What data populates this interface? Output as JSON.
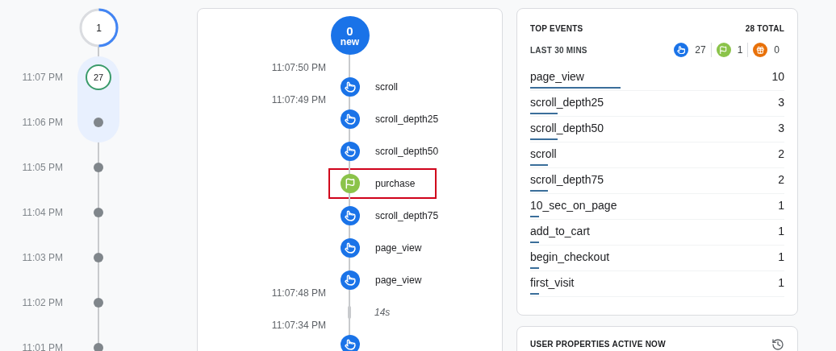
{
  "minute_timeline": {
    "current_count": "1",
    "minutes": [
      {
        "time": "11:07 PM",
        "count": "27",
        "selected": true
      },
      {
        "time": "11:06 PM",
        "selected": false
      },
      {
        "time": "11:05 PM",
        "selected": false
      },
      {
        "time": "11:04 PM",
        "selected": false
      },
      {
        "time": "11:03 PM",
        "selected": false
      },
      {
        "time": "11:02 PM",
        "selected": false
      },
      {
        "time": "11:01 PM",
        "selected": false
      }
    ]
  },
  "event_stream": {
    "new_count": "0",
    "new_label": "new",
    "items": [
      {
        "kind": "time",
        "text": "11:07:50 PM"
      },
      {
        "kind": "touch",
        "name": "scroll",
        "highlighted": false
      },
      {
        "kind": "time",
        "text": "11:07:49 PM"
      },
      {
        "kind": "touch",
        "name": "scroll_depth25",
        "highlighted": false
      },
      {
        "kind": "touch",
        "name": "scroll_depth50",
        "highlighted": false
      },
      {
        "kind": "flag",
        "name": "purchase",
        "highlighted": true
      },
      {
        "kind": "touch",
        "name": "scroll_depth75",
        "highlighted": false
      },
      {
        "kind": "touch",
        "name": "page_view",
        "highlighted": false
      },
      {
        "kind": "touch",
        "name": "page_view",
        "highlighted": false
      },
      {
        "kind": "time",
        "text": "11:07:48 PM"
      },
      {
        "kind": "gap",
        "text": "14s"
      },
      {
        "kind": "time",
        "text": "11:07:34 PM"
      },
      {
        "kind": "touch",
        "highlighted": false
      }
    ]
  },
  "top_events": {
    "title": "TOP EVENTS",
    "total": "28 TOTAL",
    "period": "LAST 30 MINS",
    "type_counts": [
      {
        "kind": "touch",
        "count": "27"
      },
      {
        "kind": "flag",
        "count": "1"
      },
      {
        "kind": "gift",
        "count": "0"
      }
    ],
    "rows": [
      {
        "name": "page_view",
        "count": "10",
        "level": 0.357
      },
      {
        "name": "scroll_depth25",
        "count": "3",
        "level": 0.107
      },
      {
        "name": "scroll_depth50",
        "count": "3",
        "level": 0.107
      },
      {
        "name": "scroll",
        "count": "2",
        "level": 0.071
      },
      {
        "name": "scroll_depth75",
        "count": "2",
        "level": 0.071
      },
      {
        "name": "10_sec_on_page",
        "count": "1",
        "level": 0.036
      },
      {
        "name": "add_to_cart",
        "count": "1",
        "level": 0.036
      },
      {
        "name": "begin_checkout",
        "count": "1",
        "level": 0.036
      },
      {
        "name": "first_visit",
        "count": "1",
        "level": 0.036
      }
    ]
  },
  "user_properties": {
    "title": "USER PROPERTIES ACTIVE NOW"
  }
}
